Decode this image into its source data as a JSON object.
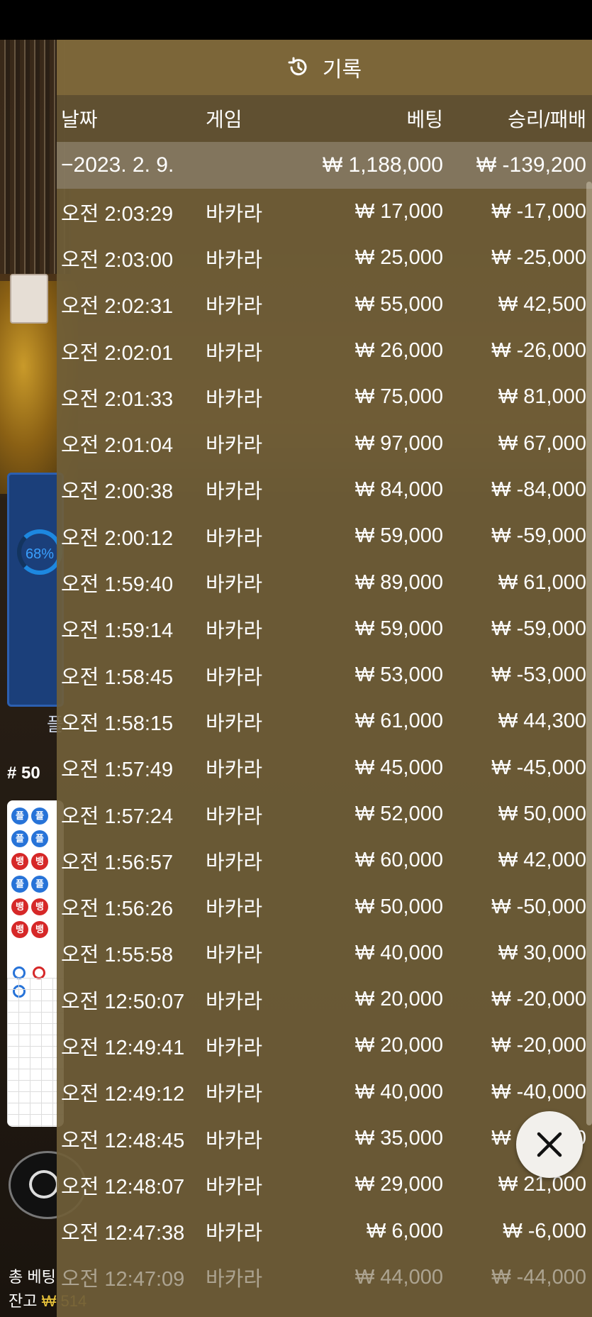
{
  "background": {
    "ring_percent": "68%",
    "panel_char": "플",
    "round_label": "# 50",
    "road_labels": {
      "player": "플",
      "banker": "뱅"
    },
    "total_bet_label": "총 베팅",
    "balance_label": "잔고",
    "balance_value": "₩ 514"
  },
  "history": {
    "title": "기록",
    "columns": {
      "date": "날짜",
      "game": "게임",
      "bet": "베팅",
      "win_loss": "승리/패배"
    },
    "summary": {
      "date": "−2023. 2. 9.",
      "bet": "₩ 1,188,000",
      "win_loss": "₩ -139,200"
    },
    "rows": [
      {
        "time": "오전 2:03:29",
        "game": "바카라",
        "bet": "₩ 17,000",
        "win_loss": "₩ -17,000"
      },
      {
        "time": "오전 2:03:00",
        "game": "바카라",
        "bet": "₩ 25,000",
        "win_loss": "₩ -25,000"
      },
      {
        "time": "오전 2:02:31",
        "game": "바카라",
        "bet": "₩ 55,000",
        "win_loss": "₩ 42,500"
      },
      {
        "time": "오전 2:02:01",
        "game": "바카라",
        "bet": "₩ 26,000",
        "win_loss": "₩ -26,000"
      },
      {
        "time": "오전 2:01:33",
        "game": "바카라",
        "bet": "₩ 75,000",
        "win_loss": "₩ 81,000"
      },
      {
        "time": "오전 2:01:04",
        "game": "바카라",
        "bet": "₩ 97,000",
        "win_loss": "₩ 67,000"
      },
      {
        "time": "오전 2:00:38",
        "game": "바카라",
        "bet": "₩ 84,000",
        "win_loss": "₩ -84,000"
      },
      {
        "time": "오전 2:00:12",
        "game": "바카라",
        "bet": "₩ 59,000",
        "win_loss": "₩ -59,000"
      },
      {
        "time": "오전 1:59:40",
        "game": "바카라",
        "bet": "₩ 89,000",
        "win_loss": "₩ 61,000"
      },
      {
        "time": "오전 1:59:14",
        "game": "바카라",
        "bet": "₩ 59,000",
        "win_loss": "₩ -59,000"
      },
      {
        "time": "오전 1:58:45",
        "game": "바카라",
        "bet": "₩ 53,000",
        "win_loss": "₩ -53,000"
      },
      {
        "time": "오전 1:58:15",
        "game": "바카라",
        "bet": "₩ 61,000",
        "win_loss": "₩ 44,300"
      },
      {
        "time": "오전 1:57:49",
        "game": "바카라",
        "bet": "₩ 45,000",
        "win_loss": "₩ -45,000"
      },
      {
        "time": "오전 1:57:24",
        "game": "바카라",
        "bet": "₩ 52,000",
        "win_loss": "₩ 50,000"
      },
      {
        "time": "오전 1:56:57",
        "game": "바카라",
        "bet": "₩ 60,000",
        "win_loss": "₩ 42,000"
      },
      {
        "time": "오전 1:56:26",
        "game": "바카라",
        "bet": "₩ 50,000",
        "win_loss": "₩ -50,000"
      },
      {
        "time": "오전 1:55:58",
        "game": "바카라",
        "bet": "₩ 40,000",
        "win_loss": "₩ 30,000"
      },
      {
        "time": "오전 12:50:07",
        "game": "바카라",
        "bet": "₩ 20,000",
        "win_loss": "₩ -20,000"
      },
      {
        "time": "오전 12:49:41",
        "game": "바카라",
        "bet": "₩ 20,000",
        "win_loss": "₩ -20,000"
      },
      {
        "time": "오전 12:49:12",
        "game": "바카라",
        "bet": "₩ 40,000",
        "win_loss": "₩ -40,000"
      },
      {
        "time": "오전 12:48:45",
        "game": "바카라",
        "bet": "₩ 35,000",
        "win_loss": "₩ -35,000"
      },
      {
        "time": "오전 12:48:07",
        "game": "바카라",
        "bet": "₩ 29,000",
        "win_loss": "₩ 21,000"
      },
      {
        "time": "오전 12:47:38",
        "game": "바카라",
        "bet": "₩ 6,000",
        "win_loss": "₩ -6,000"
      },
      {
        "time": "오전 12:47:09",
        "game": "바카라",
        "bet": "₩ 44,000",
        "win_loss": "₩ -44,000"
      }
    ]
  }
}
